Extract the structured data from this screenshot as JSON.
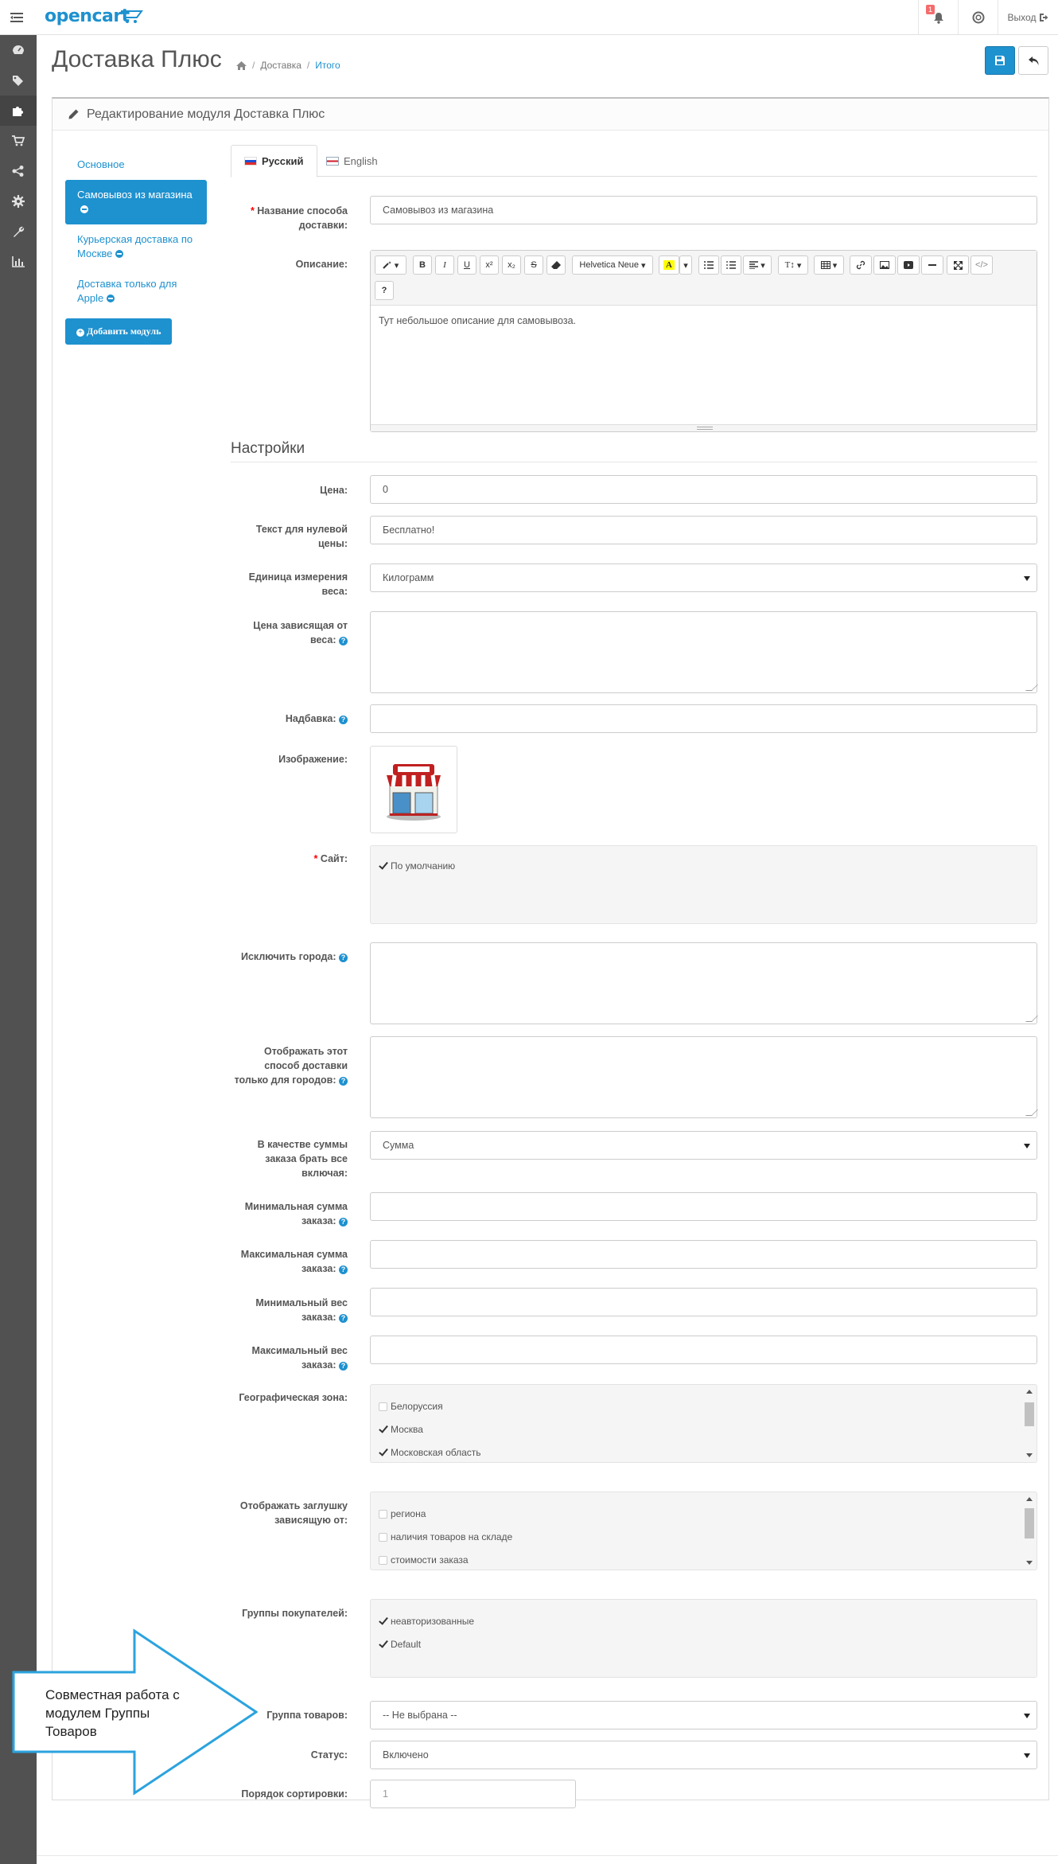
{
  "brand": {
    "logo_text": "opencart"
  },
  "header": {
    "notification_count": "1",
    "logout_label": "Выход"
  },
  "sidebar": {
    "icons": [
      "dashboard-icon",
      "tags-icon",
      "puzzle-icon",
      "cart-icon",
      "share-icon",
      "cog-icon",
      "wrench-icon",
      "bar-chart-icon"
    ]
  },
  "page": {
    "title": "Доставка Плюс",
    "breadcrumb": [
      "Доставка",
      "Итого"
    ]
  },
  "panel": {
    "heading": "Редактирование модуля Доставка Плюс"
  },
  "left_nav": {
    "items": [
      {
        "label": "Основное"
      },
      {
        "label": "Самовывоз из магазина"
      },
      {
        "label": "Курьерская доставка по Москве"
      },
      {
        "label": "Доставка только для Apple"
      }
    ],
    "add_module_label": "Добавить модуль"
  },
  "tabs": [
    {
      "label": "Русский"
    },
    {
      "label": "English"
    }
  ],
  "form": {
    "method_name": {
      "label": "Название способа доставки:",
      "value": "Самовывоз из магазина"
    },
    "description": {
      "label": "Описание:",
      "font_name": "Helvetica Neue",
      "help_button": "?",
      "content": "Тут небольшое описание для самовывоза."
    },
    "section_title": "Настройки",
    "price": {
      "label": "Цена:",
      "value": "0"
    },
    "zero_price_text": {
      "label": "Текст для нулевой цены:",
      "value": "Бесплатно!"
    },
    "weight_unit": {
      "label": "Единица измерения веса:",
      "value": "Килограмм"
    },
    "weight_price": {
      "label": "Цена зависящая от веса:"
    },
    "markup": {
      "label": "Надбавка:"
    },
    "image": {
      "label": "Изображение:"
    },
    "site": {
      "label": "Сайт:",
      "options": [
        {
          "label": "По умолчанию",
          "checked": true
        }
      ]
    },
    "exclude_cities": {
      "label": "Исключить города:"
    },
    "only_cities": {
      "label": "Отображать этот способ доставки только для городов:"
    },
    "order_total": {
      "label": "В качестве суммы заказа брать все включая:",
      "value": "Сумма"
    },
    "min_total": {
      "label": "Минимальная сумма заказа:"
    },
    "max_total": {
      "label": "Максимальная сумма заказа:"
    },
    "min_weight": {
      "label": "Минимальный вес заказа:"
    },
    "max_weight": {
      "label": "Максимальный вес заказа:"
    },
    "geo_zone": {
      "label": "Географическая зона:",
      "options": [
        {
          "label": "Белоруссия",
          "checked": false
        },
        {
          "label": "Москва",
          "checked": true
        },
        {
          "label": "Московская область",
          "checked": true
        }
      ]
    },
    "stub": {
      "label": "Отображать заглушку зависящую от:",
      "options": [
        {
          "label": "региона",
          "checked": false
        },
        {
          "label": "наличия товаров на складе",
          "checked": false
        },
        {
          "label": "стоимости заказа",
          "checked": false
        }
      ]
    },
    "customer_groups": {
      "label": "Группы покупателей:",
      "options": [
        {
          "label": "неавторизованные",
          "checked": true
        },
        {
          "label": "Default",
          "checked": true
        }
      ]
    },
    "product_group": {
      "label": "Группа товаров:",
      "value": "-- Не выбрана --"
    },
    "status": {
      "label": "Статус:",
      "value": "Включено"
    },
    "sort_order": {
      "label": "Порядок сортировки:",
      "placeholder": "1"
    }
  },
  "callout": {
    "text": "Совместная работа с модулем Группы Товаров"
  },
  "colors": {
    "primary": "#1e91cf",
    "sidebar": "#515151",
    "required": "#ff0000"
  }
}
